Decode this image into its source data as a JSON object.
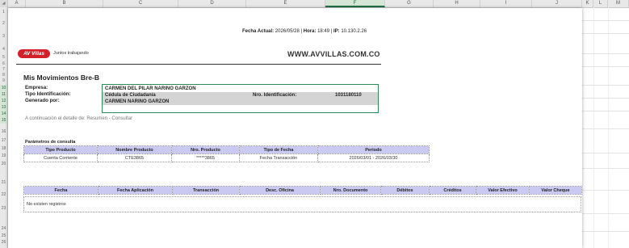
{
  "spreadsheet": {
    "columns": [
      "A",
      "B",
      "C",
      "D",
      "E",
      "F",
      "G",
      "H",
      "I",
      "J",
      "K",
      "L",
      "M"
    ],
    "selected_column": "F",
    "rows": [
      "1",
      "2",
      "3",
      "4",
      "5",
      "6",
      "7",
      "8",
      "9",
      "10",
      "11",
      "12",
      "13",
      "14",
      "15",
      "16",
      "17",
      "18",
      "19",
      "20",
      "21",
      "22",
      "23",
      "24",
      "25",
      "26"
    ],
    "selected_rows": [
      "10",
      "11",
      "12",
      "13",
      "14",
      "15"
    ]
  },
  "report": {
    "fecha_label": "Fecha Actual:",
    "fecha_value": "2026/05/28",
    "hora_label": "Hora:",
    "hora_value": "18:49",
    "ip_label": "IP:",
    "ip_value": "10.130.2.26",
    "separator": "|",
    "logo_text": "AV Villas",
    "logo_tagline": "Juntos trabajando",
    "website": "WWW.AVVILLAS.COM.CO",
    "title": "Mis Movimientos Bre-B",
    "empresa_label": "Empresa:",
    "empresa_value": "CARMEN DEL PILAR NARINO GARZON",
    "tipo_id_label": "Tipo Identificación:",
    "tipo_id_value": "Cédula de Ciudadanía",
    "nro_id_label": "Nro. Identificación:",
    "nro_id_value": "1031180110",
    "generado_label": "Generado por:",
    "generado_value": "CARMEN NARINO GARZON",
    "detalle_text": "A continuación el detalle de: Resumen - Consultar",
    "params_label": "Parámetros de consulta"
  },
  "params_table": {
    "headers": [
      "Tipo Producto",
      "Nombre Producto",
      "Nro. Producto",
      "Tipo de Fecha",
      "Periodo"
    ],
    "row": [
      "Cuenta Corriente",
      "CTE3865",
      "*****3865",
      "Fecha Transacción",
      "2026/03/01 - 2026/03/30"
    ]
  },
  "movements_table": {
    "headers": [
      "Fecha",
      "Fecha Aplicación",
      "Transacción",
      "Desc. Oficina",
      "Nro. Documento",
      "Débitos",
      "Créditos",
      "Valor Efectivo",
      "Valor Cheque"
    ],
    "empty_text": "No existen registros"
  },
  "colors": {
    "brand_red": "#d3212c",
    "table_header": "#c9c9f2",
    "selection_green": "#217346",
    "gray_band": "#d4d4d4"
  }
}
